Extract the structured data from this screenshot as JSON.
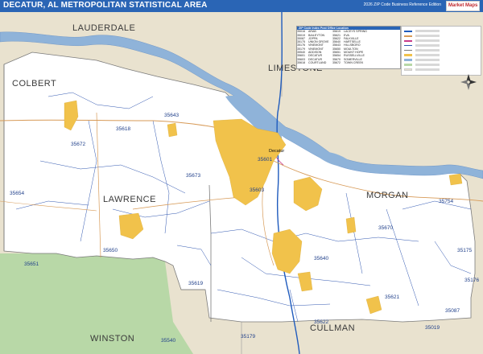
{
  "header": {
    "title": "DECATUR, AL METROPOLITAN STATISTICAL AREA",
    "edition": "2026 ZIP Code Business Reference Edition",
    "logo_text": "Market Maps"
  },
  "counties": {
    "lauderdale": "LAUDERDALE",
    "limestone": "LIMESTONE",
    "colbert": "COLBERT",
    "lawrence": "LAWRENCE",
    "morgan": "MORGAN",
    "winston": "WINSTON",
    "cullman": "CULLMAN"
  },
  "zips": {
    "z35643": "35643",
    "z35618": "35618",
    "z35672": "35672",
    "z35601": "35601",
    "z35603": "35603",
    "z35673": "35673",
    "z35654": "35654",
    "z35670": "35670",
    "z35754": "35754",
    "z35650": "35650",
    "z35651": "35651",
    "z35640": "35640",
    "z35175": "35175",
    "z35619": "35619",
    "z35621": "35621",
    "z35087": "35087",
    "z35622": "35622",
    "z35179": "35179",
    "z35540": "35540",
    "z35019": "35019",
    "z35176": "35176"
  },
  "cities": {
    "decatur": "Decatur"
  },
  "zip_table": {
    "header": "ZIP Code Index  Post Office Location",
    "rows": [
      [
        "35016",
        "ARAB",
        "35619",
        "LACEYS SPRING"
      ],
      [
        "35019",
        "BAILEYTON",
        "35621",
        "EVA"
      ],
      [
        "35087",
        "JOPPA",
        "35622",
        "FALKVILLE"
      ],
      [
        "35175",
        "UNION GROVE",
        "35640",
        "HARTSELLE"
      ],
      [
        "35176",
        "VINEMONT",
        "35643",
        "HILLSBORO"
      ],
      [
        "35179",
        "VINEMONT",
        "35650",
        "MOULTON"
      ],
      [
        "35540",
        "ADDISON",
        "35651",
        "MOUNT HOPE"
      ],
      [
        "35601",
        "DECATUR",
        "35654",
        "RUSSELLVILLE"
      ],
      [
        "35603",
        "DECATUR",
        "35670",
        "SOMERVILLE"
      ],
      [
        "35618",
        "COURTLAND",
        "35672",
        "TOWN CREEK"
      ]
    ]
  },
  "legend": {
    "label": "Legend"
  },
  "compass": {
    "n": "N"
  },
  "colors": {
    "water": "#8fb3d9",
    "outside": "#e9e2cf",
    "forest": "#b8d8a7",
    "urban": "#f1c24b",
    "county_line": "#7a7a7a",
    "zip_line": "#2f56b0",
    "interstate": "#1f5bbd",
    "highway": "#d79a57",
    "title_bar": "#2a65b5"
  }
}
